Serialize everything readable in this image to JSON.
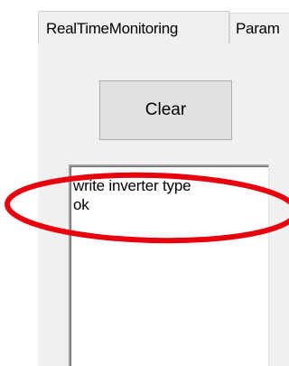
{
  "tabs": [
    {
      "label": "RealTimeMonitoring"
    },
    {
      "label": "Param"
    }
  ],
  "clear_button": {
    "label": "Clear"
  },
  "log": {
    "lines": [
      "write inverter type",
      "ok"
    ]
  },
  "annotation": {
    "color": "#e8000d"
  }
}
